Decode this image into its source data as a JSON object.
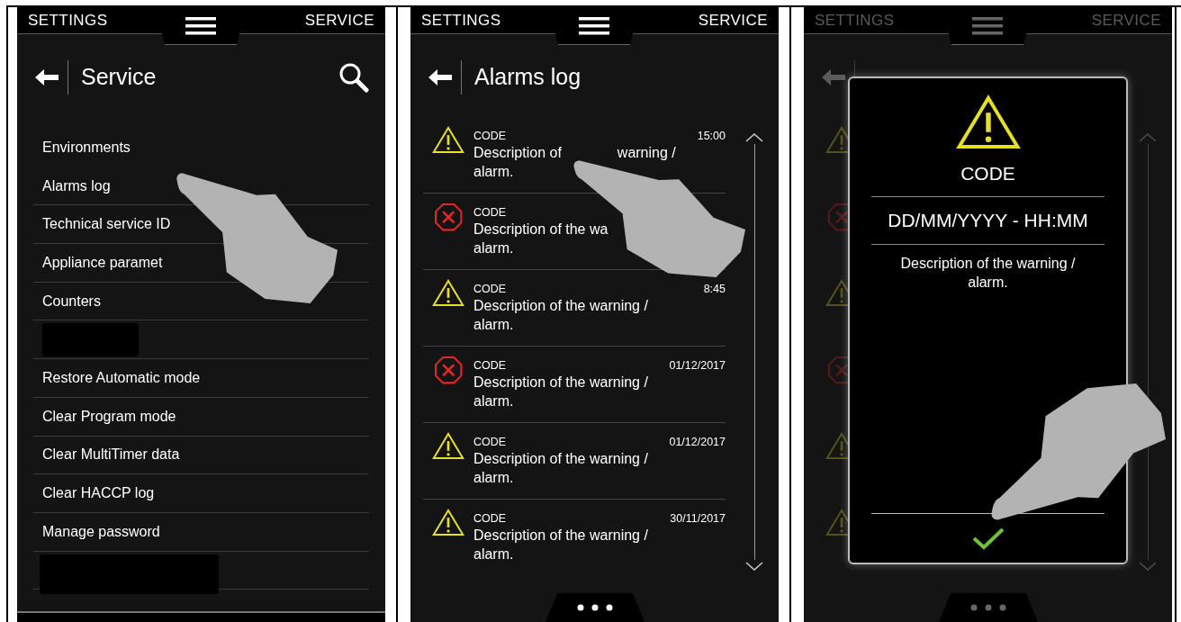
{
  "screens": [
    {
      "kind": "menu",
      "dimmed": false,
      "header": {
        "left": "SETTINGS",
        "right": "SERVICE"
      },
      "title": "Service",
      "search": true,
      "items": [
        {
          "kind": "text",
          "label": "Environments"
        },
        {
          "kind": "text",
          "label": "Alarms log"
        },
        {
          "kind": "text",
          "label": "Technical service ID"
        },
        {
          "kind": "text",
          "label": "Appliance paramet"
        },
        {
          "kind": "text",
          "label": "Counters"
        },
        {
          "kind": "redacted"
        },
        {
          "kind": "text",
          "label": "Restore Automatic mode"
        },
        {
          "kind": "text",
          "label": "Clear Program mode"
        },
        {
          "kind": "text",
          "label": "Clear MultiTimer data"
        },
        {
          "kind": "text",
          "label": "Clear HACCP log"
        },
        {
          "kind": "text",
          "label": "Manage password"
        },
        {
          "kind": "redacted_wide"
        }
      ]
    },
    {
      "kind": "alarms",
      "dimmed": false,
      "header": {
        "left": "SETTINGS",
        "right": "SERVICE"
      },
      "title": "Alarms log",
      "search": false,
      "rows": [
        {
          "kind": "warning",
          "code": "CODE",
          "time": "15:00",
          "description": [
            [
              "Description of",
              "warning /"
            ],
            [
              "alarm."
            ]
          ]
        },
        {
          "kind": "error",
          "code": "CODE",
          "description": [
            [
              "Description of the wa"
            ],
            [
              "alarm."
            ]
          ]
        },
        {
          "kind": "warning",
          "code": "CODE",
          "time": "8:45",
          "description": [
            [
              "Description of the warning /"
            ],
            [
              "alarm."
            ]
          ]
        },
        {
          "kind": "error",
          "code": "CODE",
          "time": "01/12/2017",
          "description": [
            [
              "Description of the warning /"
            ],
            [
              "alarm."
            ]
          ]
        },
        {
          "kind": "warning",
          "code": "CODE",
          "time": "01/12/2017",
          "description": [
            [
              "Description of the warning /"
            ],
            [
              "alarm."
            ]
          ]
        },
        {
          "kind": "warning",
          "code": "CODE",
          "time": "30/11/2017",
          "description": [
            [
              "Description of the warning /"
            ],
            [
              "alarm."
            ]
          ]
        }
      ]
    },
    {
      "kind": "dialog",
      "dimmed": true,
      "header": {
        "left": "SETTINGS",
        "right": "SERVICE"
      },
      "background_icons": [
        {
          "kind": "warning"
        },
        {
          "kind": "error"
        },
        {
          "kind": "warning"
        },
        {
          "kind": "error"
        },
        {
          "kind": "warning"
        },
        {
          "kind": "warning"
        }
      ],
      "dialog": {
        "kind": "warning",
        "code": "CODE",
        "datetime": "DD/MM/YYYY - HH:MM",
        "description": [
          "Description of the warning /",
          "alarm."
        ]
      }
    }
  ]
}
